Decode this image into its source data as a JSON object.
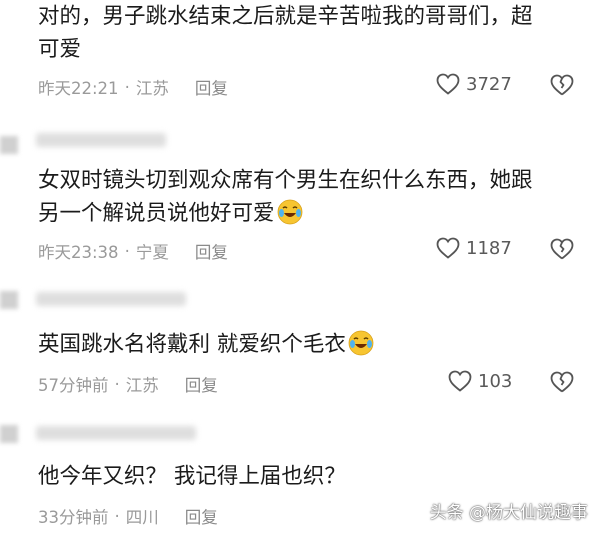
{
  "comments": [
    {
      "text_line1": "对的，男子跳水结束之后就是辛苦啦我的哥哥们，超",
      "text_line2": "可爱",
      "time": "昨天22:21",
      "location": "江苏",
      "reply_label": "回复",
      "likes": "3727"
    },
    {
      "text_line1": "女双时镜头切到观众席有个男生在织什么东西，她跟",
      "text_line2": "另一个解说员说他好可爱",
      "time": "昨天23:38",
      "location": "宁夏",
      "reply_label": "回复",
      "likes": "1187"
    },
    {
      "text_line1": "英国跳水名将戴利 就爱织个毛衣",
      "time": "57分钟前",
      "location": "江苏",
      "reply_label": "回复",
      "likes": "103"
    },
    {
      "text_line1": "他今年又织？ 我记得上届也织？",
      "time": "33分钟前",
      "location": "四川",
      "reply_label": "回复"
    }
  ],
  "separator": "·",
  "watermark": "头条 @杨大仙说趣事",
  "icons": {
    "like": "heart-outline-icon",
    "dislike": "broken-heart-icon",
    "emoji": "laughing-tears-emoji-icon"
  },
  "colors": {
    "text": "#1b1b1b",
    "meta": "#9a9a9a",
    "icon": "#555555"
  }
}
